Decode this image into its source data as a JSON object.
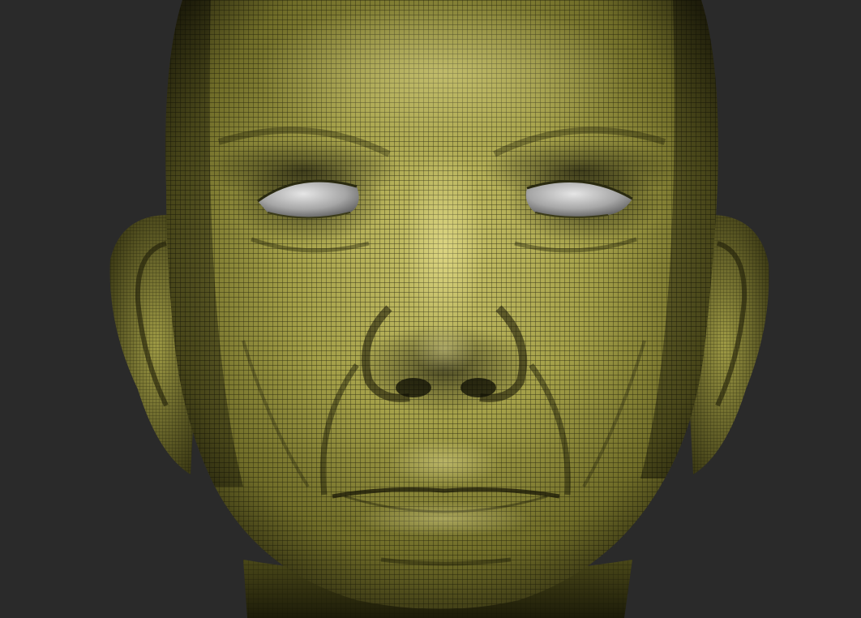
{
  "viewport": {
    "background_color": "#2a2a2a",
    "model": {
      "subject": "head-sculpt",
      "display_mode": "polyframe-wireframe",
      "skin_color": "#8c8838",
      "skin_highlight_color": "#c9c36a",
      "skin_shadow_color": "#2e2c10",
      "wire_color": "#141405",
      "eye_color": "#a6a6a6",
      "eye_highlight_color": "#e6e6e6"
    }
  }
}
